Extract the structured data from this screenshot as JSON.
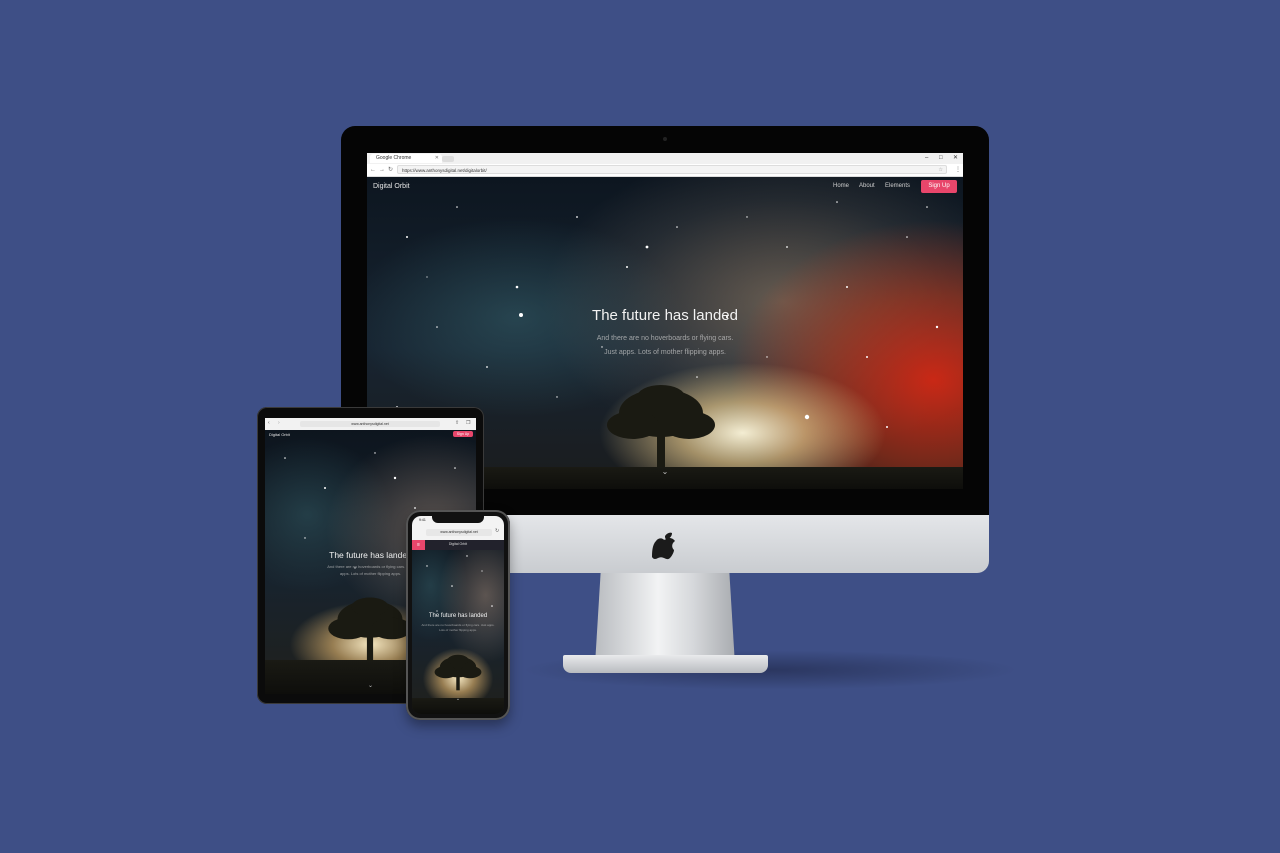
{
  "colors": {
    "background": "#3e4f86",
    "accent": "#e8466b"
  },
  "imac": {
    "browser": {
      "tab_title": "Google Chrome",
      "url": "https://www.anthonysdigital.net/digitalorbit/",
      "minimize_icon": "minimize-icon",
      "maximize_icon": "maximize-icon",
      "close_icon": "close-icon"
    },
    "site": {
      "logo": "Digital Orbit",
      "nav": [
        "Home",
        "About",
        "Elements"
      ],
      "signup": "Sign Up",
      "hero_title": "The future has landed",
      "hero_sub_line1": "And there are no hoverboards or flying cars.",
      "hero_sub_line2": "Just apps. Lots of mother flipping apps."
    }
  },
  "ipad": {
    "url": "www.anthonysdigital.net",
    "logo": "Digital Orbit",
    "signup": "Sign Up",
    "hero_title": "The future has landed",
    "hero_sub": "And there are no hoverboards or flying cars. Just apps. Lots of mother flipping apps."
  },
  "iphone": {
    "time": "9:41",
    "url": "www.anthonysdigital.net",
    "logo": "Digital Orbit",
    "menu_icon": "menu-icon",
    "hero_title": "The future has landed",
    "hero_sub": "And there are no hoverboards or flying cars. Just apps. Lots of mother flipping apps."
  }
}
